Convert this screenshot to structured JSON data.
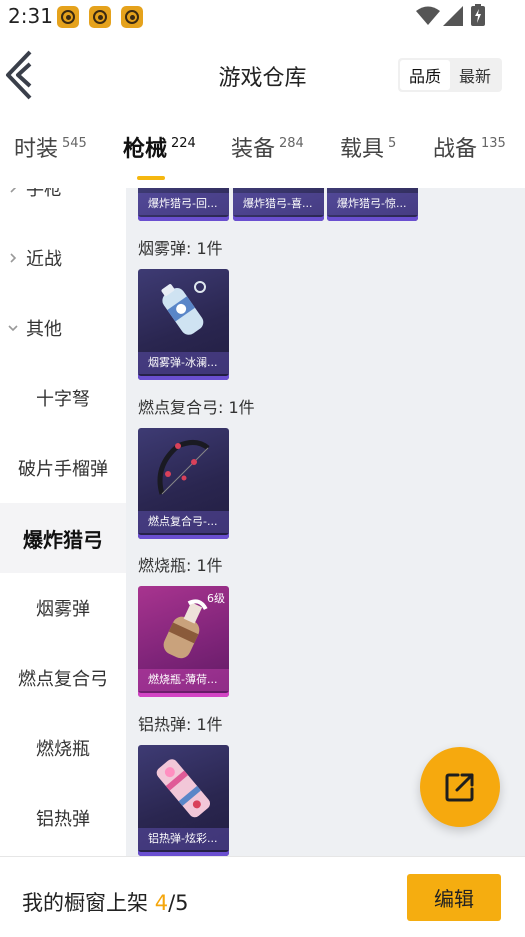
{
  "status_bar": {
    "time": "2:31"
  },
  "header": {
    "title": "游戏仓库",
    "sort_options": [
      "品质",
      "最新"
    ]
  },
  "tabs": [
    {
      "label": "时装",
      "count": "545"
    },
    {
      "label": "枪械",
      "count": "224"
    },
    {
      "label": "装备",
      "count": "284"
    },
    {
      "label": "载具",
      "count": "5"
    },
    {
      "label": "战备",
      "count": "135"
    }
  ],
  "sidebar": {
    "items": [
      {
        "label": "手枪"
      },
      {
        "label": "近战"
      },
      {
        "label": "其他"
      },
      {
        "label": "十字弩"
      },
      {
        "label": "破片手榴弹"
      },
      {
        "label": "爆炸猎弓"
      },
      {
        "label": "烟雾弹"
      },
      {
        "label": "燃点复合弓"
      },
      {
        "label": "燃烧瓶"
      },
      {
        "label": "铝热弹"
      }
    ]
  },
  "content": {
    "top_cards": [
      "爆炸猎弓-回...",
      "爆炸猎弓-喜...",
      "爆炸猎弓-惊..."
    ],
    "sections": [
      {
        "header": "烟雾弹: 1件",
        "card": "烟雾弹-冰澜..."
      },
      {
        "header": "燃点复合弓: 1件",
        "card": "燃点复合弓-..."
      },
      {
        "header": "燃烧瓶: 1件",
        "card": "燃烧瓶-薄荷...",
        "badge": "6级"
      },
      {
        "header": "铝热弹: 1件",
        "card": "铝热弹-炫彩..."
      }
    ]
  },
  "bottom_bar": {
    "label": "我的橱窗上架 ",
    "count_current": "4",
    "count_total": "/5",
    "edit_label": "编辑"
  },
  "colors": {
    "accent": "#f5ad10",
    "card_purple": "#2a2650",
    "card_pink": "#7f2479",
    "content_bg": "#eef0f3"
  },
  "icons": [
    "notification-app-icon",
    "wifi-icon",
    "signal-icon",
    "battery-icon",
    "back-arrow-icon",
    "chevron-right-icon",
    "chevron-down-icon",
    "share-icon"
  ]
}
